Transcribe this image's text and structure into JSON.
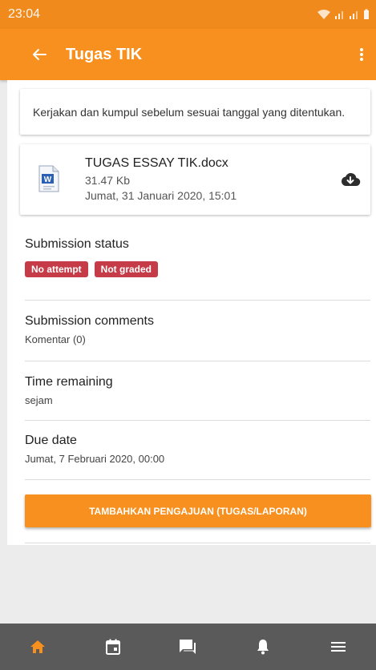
{
  "status_bar": {
    "time": "23:04"
  },
  "app_bar": {
    "title": "Tugas TIK"
  },
  "intro": {
    "text": "Kerjakan dan kumpul sebelum sesuai tanggal yang ditentukan."
  },
  "file": {
    "name": "TUGAS ESSAY TIK.docx",
    "size": "31.47 Kb",
    "date": "Jumat, 31 Januari 2020, 15:01"
  },
  "submission_status": {
    "label": "Submission status",
    "badges": [
      "No attempt",
      "Not graded"
    ]
  },
  "submission_comments": {
    "label": "Submission comments",
    "value": "Komentar (0)"
  },
  "time_remaining": {
    "label": "Time remaining",
    "value": "sejam"
  },
  "due_date": {
    "label": "Due date",
    "value": "Jumat, 7 Februari 2020, 00:00"
  },
  "action_button": {
    "label": "TAMBAHKAN PENGAJUAN (TUGAS/LAPORAN)"
  },
  "bottom_nav": {
    "items": [
      "home-icon",
      "calendar-icon",
      "messages-icon",
      "notifications-icon",
      "menu-icon"
    ],
    "active": "home-icon"
  },
  "colors": {
    "accent": "#f7901e",
    "badge": "#c53b47",
    "nav_background": "#5a5a5a",
    "nav_active": "#f7901e",
    "nav_inactive": "#ffffff"
  }
}
